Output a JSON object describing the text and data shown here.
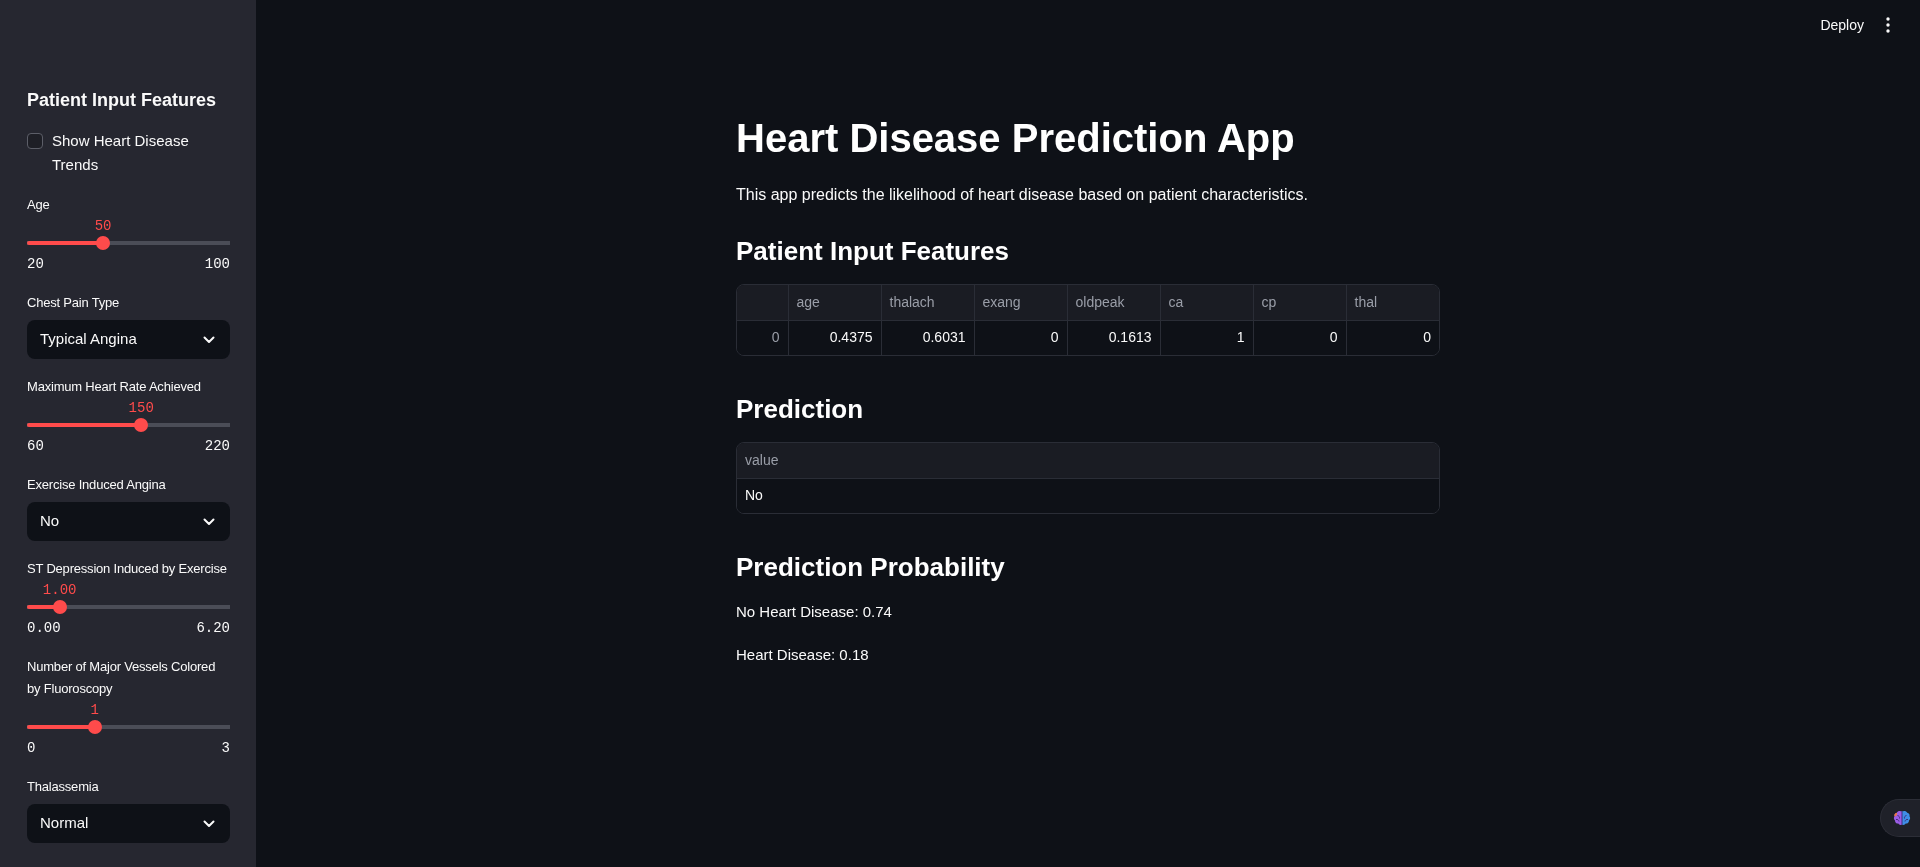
{
  "header": {
    "deploy_label": "Deploy"
  },
  "sidebar": {
    "title": "Patient Input Features",
    "controls": [
      {
        "kind": "checkbox",
        "label": "Show Heart Disease Trends",
        "checked": false
      },
      {
        "kind": "slider",
        "label": "Age",
        "value": "50",
        "min": "20",
        "max": "100",
        "level": 0.375
      },
      {
        "kind": "select",
        "label": "Chest Pain Type",
        "value": "Typical Angina"
      },
      {
        "kind": "slider",
        "label": "Maximum Heart Rate Achieved",
        "value": "150",
        "min": "60",
        "max": "220",
        "level": 0.5625
      },
      {
        "kind": "select",
        "label": "Exercise Induced Angina",
        "value": "No"
      },
      {
        "kind": "slider",
        "label": "ST Depression Induced by Exercise",
        "value": "1.00",
        "min": "0.00",
        "max": "6.20",
        "level": 0.161
      },
      {
        "kind": "slider",
        "label": "Number of Major Vessels Colored by Fluoroscopy",
        "value": "1",
        "min": "0",
        "max": "3",
        "level": 0.333
      },
      {
        "kind": "select",
        "label": "Thalassemia",
        "value": "Normal"
      }
    ]
  },
  "main": {
    "title": "Heart Disease Prediction App",
    "description": "This app predicts the likelihood of heart disease based on patient characteristics.",
    "sections": [
      {
        "kind": "table",
        "heading": "Patient Input Features",
        "columns": [
          {
            "label": "age",
            "kind": "number"
          },
          {
            "label": "thalach",
            "kind": "number"
          },
          {
            "label": "exang",
            "kind": "number"
          },
          {
            "label": "oldpeak",
            "kind": "number"
          },
          {
            "label": "ca",
            "kind": "number"
          },
          {
            "label": "cp",
            "kind": "number"
          },
          {
            "label": "thal",
            "kind": "number"
          }
        ],
        "rows": [
          {
            "index": "0",
            "cells": [
              "0.4375",
              "0.6031",
              "0",
              "0.1613",
              "1",
              "0",
              "0"
            ]
          }
        ]
      },
      {
        "kind": "table",
        "heading": "Prediction",
        "columns": [
          {
            "label": "value",
            "kind": "text"
          }
        ],
        "rows": [
          {
            "cells": [
              "No"
            ]
          }
        ]
      },
      {
        "kind": "text",
        "heading": "Prediction Probability",
        "lines": [
          "No Heart Disease: 0.74",
          "Heart Disease: 0.18"
        ]
      }
    ]
  }
}
